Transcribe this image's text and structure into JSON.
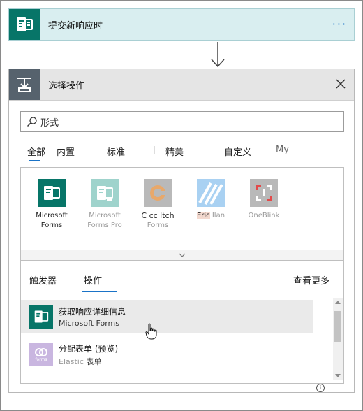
{
  "trigger": {
    "title": "提交新响应时",
    "more_label": "···",
    "icon": "forms-icon",
    "color": "#077568"
  },
  "action_panel": {
    "title": "选择操作",
    "icon": "action-icon",
    "color": "#56626d",
    "search": {
      "value": "形式",
      "placeholder": ""
    },
    "tabs": [
      {
        "label": "全部",
        "selected": true
      },
      {
        "label": "内置"
      },
      {
        "label": "标准"
      },
      {
        "label": "精美"
      },
      {
        "label": "自定义"
      },
      {
        "label": "My"
      }
    ],
    "connectors": [
      {
        "name_line1": "Microsoft",
        "name_line2": "Forms",
        "icon": "forms-icon",
        "color": "#077568"
      },
      {
        "name_line1": "Microsoft",
        "name_line2": "Forms Pro",
        "icon": "forms-pro-icon",
        "color": "#9fd3cc"
      },
      {
        "name_line1": "C cc ltch",
        "name_line2": "Forms",
        "icon": "cognito-forms-icon",
        "color": "#e8a86a"
      },
      {
        "name_line1": "Eric",
        "name_line2": "Ilan",
        "icon": "stripes-icon",
        "color": "#a9d1f2"
      },
      {
        "name_line1": "OneBlink",
        "name_line2": "",
        "icon": "oneblink-icon",
        "color": "#b9b9b9"
      }
    ],
    "subtabs": [
      {
        "label": "触发器"
      },
      {
        "label": "操作",
        "selected": true
      }
    ],
    "see_more": "查看更多",
    "results": [
      {
        "title": "获取响应详细信息",
        "subtitle": "Microsoft Forms",
        "icon": "forms-icon",
        "color": "#077568",
        "info": "i"
      },
      {
        "title": "分配表单 (预览)",
        "subtitle_part1": "Elastic",
        "subtitle_part2": "表单",
        "icon": "elastic-forms-icon",
        "color": "#c9b6e0",
        "icon_caption": "forms",
        "info": "i"
      }
    ]
  }
}
